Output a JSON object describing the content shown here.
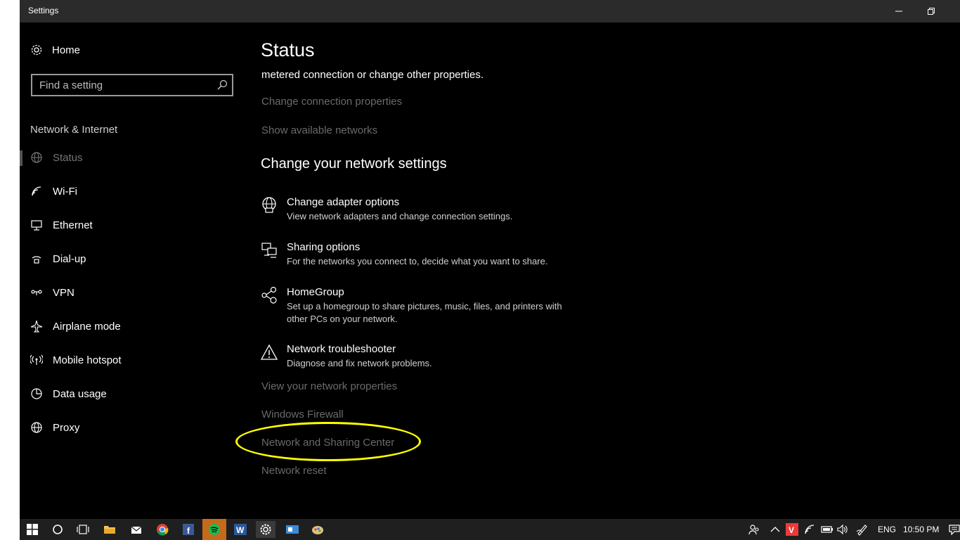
{
  "window": {
    "title": "Settings"
  },
  "sidebar": {
    "home_label": "Home",
    "search_placeholder": "Find a setting",
    "section_title": "Network & Internet",
    "items": [
      {
        "label": "Status",
        "icon": "globe-icon",
        "selected": true
      },
      {
        "label": "Wi-Fi",
        "icon": "wifi-icon"
      },
      {
        "label": "Ethernet",
        "icon": "ethernet-icon"
      },
      {
        "label": "Dial-up",
        "icon": "dialup-icon"
      },
      {
        "label": "VPN",
        "icon": "vpn-icon"
      },
      {
        "label": "Airplane mode",
        "icon": "airplane-icon"
      },
      {
        "label": "Mobile hotspot",
        "icon": "hotspot-icon"
      },
      {
        "label": "Data usage",
        "icon": "data-usage-icon"
      },
      {
        "label": "Proxy",
        "icon": "proxy-globe-icon"
      }
    ]
  },
  "main": {
    "title": "Status",
    "cut_text": "metered connection or change other properties.",
    "links_top": {
      "change_connection": "Change connection properties",
      "show_networks": "Show available networks"
    },
    "section_heading": "Change your network settings",
    "options": [
      {
        "title": "Change adapter options",
        "desc": "View network adapters and change connection settings.",
        "icon": "adapter-icon"
      },
      {
        "title": "Sharing options",
        "desc": "For the networks you connect to, decide what you want to share.",
        "icon": "sharing-icon"
      },
      {
        "title": "HomeGroup",
        "desc": "Set up a homegroup to share pictures, music, files, and printers with other PCs on your network.",
        "icon": "homegroup-icon"
      },
      {
        "title": "Network troubleshooter",
        "desc": "Diagnose and fix network problems.",
        "icon": "warning-icon"
      }
    ],
    "links_bottom": {
      "view_properties": "View your network properties",
      "firewall": "Windows Firewall",
      "sharing_center": "Network and Sharing Center",
      "reset": "Network reset"
    },
    "highlight_color": "#ffff00"
  },
  "taskbar": {
    "tray_lang": "ENG",
    "clock": "10:50 PM"
  }
}
